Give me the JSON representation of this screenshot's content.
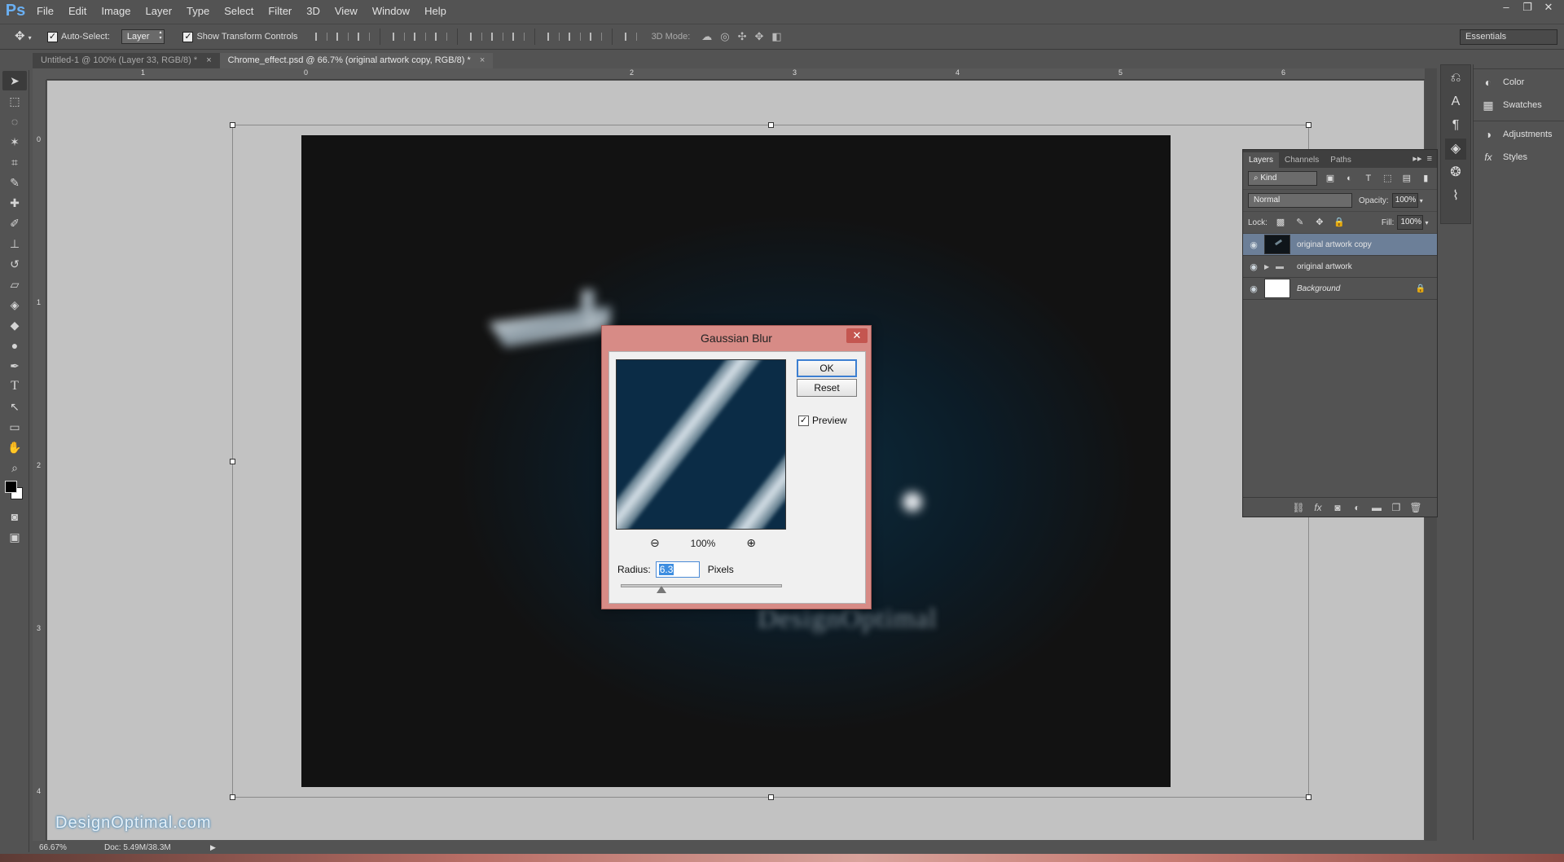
{
  "app": {
    "logo": "Ps"
  },
  "menu": [
    "File",
    "Edit",
    "Image",
    "Layer",
    "Type",
    "Select",
    "Filter",
    "3D",
    "View",
    "Window",
    "Help"
  ],
  "window_controls": {
    "minimize": "–",
    "restore": "❐",
    "close": "✕"
  },
  "options_bar": {
    "auto_select_label": "Auto-Select:",
    "auto_select_checked": "✓",
    "auto_select_value": "Layer",
    "show_transform_label": "Show Transform Controls",
    "show_transform_checked": "✓",
    "mode_3d_label": "3D Mode:",
    "workspace": "Essentials"
  },
  "tabs": [
    {
      "label": "Untitled-1 @ 100% (Layer 33, RGB/8) *",
      "close": "×"
    },
    {
      "label": "Chrome_effect.psd @ 66.7% (original artwork copy, RGB/8) *",
      "close": "×"
    }
  ],
  "ruler_h": [
    "1",
    "0",
    "2",
    "3",
    "4",
    "5",
    "6"
  ],
  "ruler_v": [
    "0",
    "1",
    "2",
    "3",
    "4"
  ],
  "canvas": {
    "artwork_text": "DesignOptimal",
    "watermark": "DesignOptimal.com"
  },
  "status": {
    "zoom": "66.67%",
    "doc": "Doc: 5.49M/38.3M",
    "arrow": "▶"
  },
  "dock": {
    "group1": [
      {
        "label": "Color",
        "icon": "palette-icon"
      },
      {
        "label": "Swatches",
        "icon": "grid-icon"
      }
    ],
    "group2": [
      {
        "label": "Adjustments",
        "icon": "circle-half-icon"
      },
      {
        "label": "Styles",
        "icon": "fx-icon"
      }
    ]
  },
  "layers_panel": {
    "tabs": [
      "Layers",
      "Channels",
      "Paths"
    ],
    "collapse": "▸▸",
    "kind": "⌕ Kind",
    "blend_mode": "Normal",
    "opacity_label": "Opacity:",
    "opacity_value": "100%",
    "lock_label": "Lock:",
    "fill_label": "Fill:",
    "fill_value": "100%",
    "layers": [
      {
        "name": "original artwork copy",
        "selected": true
      },
      {
        "name": "original artwork",
        "group": true
      },
      {
        "name": "Background",
        "locked": true
      }
    ]
  },
  "dialog": {
    "title": "Gaussian Blur",
    "close": "✕",
    "ok": "OK",
    "reset": "Reset",
    "preview_label": "Preview",
    "preview_checked": "✓",
    "zoom_level": "100%",
    "radius_label": "Radius:",
    "radius_value": "6.3",
    "radius_unit": "Pixels",
    "slider_value": 6.3
  }
}
